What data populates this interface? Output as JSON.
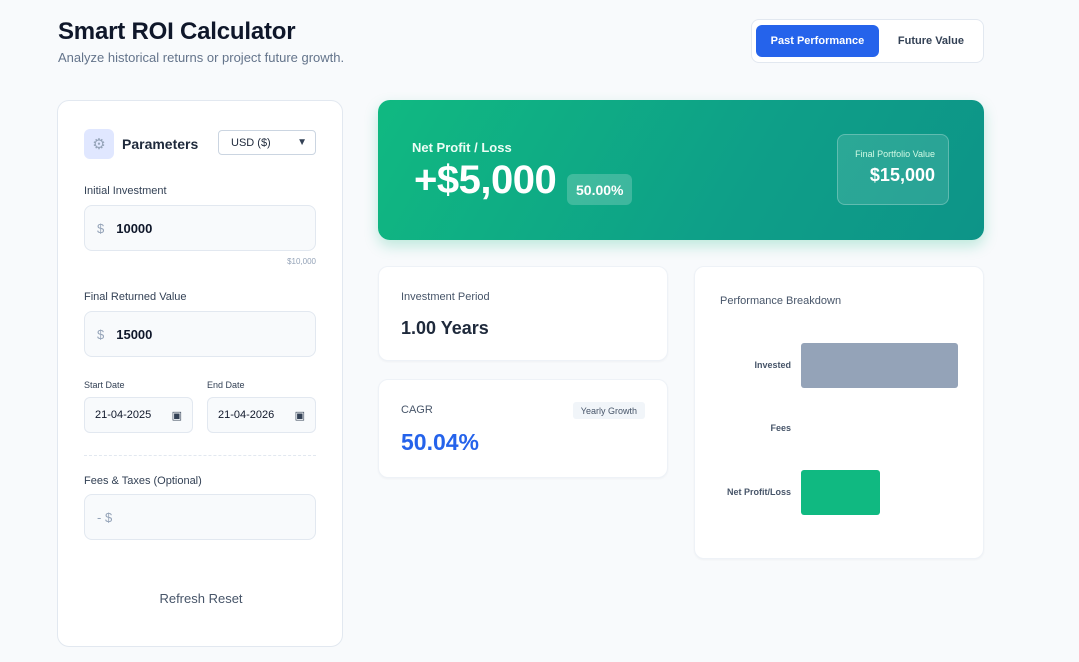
{
  "header": {
    "title": "Smart ROI Calculator",
    "subtitle": "Analyze historical returns or project future growth."
  },
  "mode_toggle": {
    "options": [
      "Past Performance",
      "Future Value"
    ],
    "selected": "Past Performance"
  },
  "params": {
    "title": "Parameters",
    "gear_icon": "gear-icon",
    "currency": "USD ($)",
    "initial_investment": {
      "label": "Initial Investment",
      "prefix": "$",
      "value": "10000",
      "hint": "$10,000"
    },
    "final_value": {
      "label": "Final Returned Value",
      "prefix": "$",
      "value": "15000"
    },
    "start_date": {
      "label": "Start Date",
      "value": "21-04-2025"
    },
    "end_date": {
      "label": "End Date",
      "value": "21-04-2026"
    },
    "fees": {
      "label": "Fees & Taxes (Optional)",
      "prefix": "- $",
      "value": ""
    },
    "actions_text": "Refresh Reset"
  },
  "summary": {
    "label": "Net Profit / Loss",
    "amount": "+$5,000",
    "percent": "50.00%",
    "final_label": "Final Portfolio Value",
    "final_value": "$15,000",
    "accent": "#10b981"
  },
  "period": {
    "label": "Investment Period",
    "value": "1.00 Years"
  },
  "cagr": {
    "label": "CAGR",
    "badge": "Yearly Growth",
    "value": "50.04%",
    "color": "#2563eb"
  },
  "breakdown": {
    "title": "Performance Breakdown",
    "chart_data": {
      "type": "bar",
      "orientation": "horizontal",
      "categories": [
        "Invested",
        "Fees",
        "Net Profit/Loss"
      ],
      "values": [
        10000,
        0,
        5000
      ],
      "colors": [
        "#94a3b8",
        "#94a3b8",
        "#10b981"
      ],
      "xlim": [
        0,
        10000
      ]
    }
  }
}
